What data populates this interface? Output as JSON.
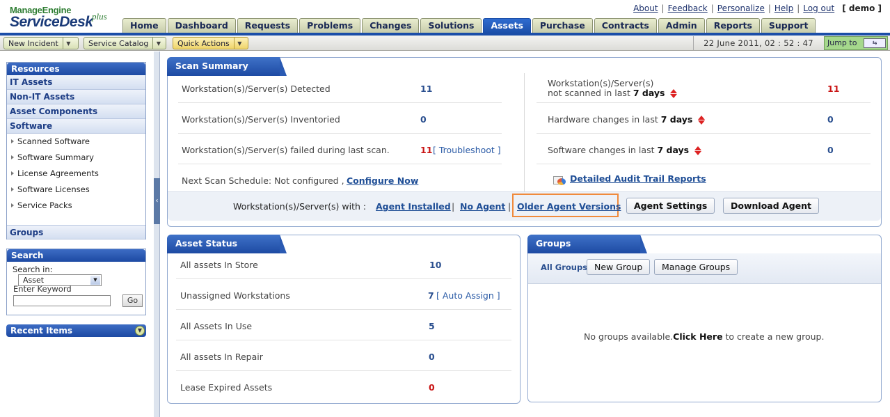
{
  "header": {
    "logo_line1": "ManageEngine",
    "logo_line2": "ServiceDesk",
    "logo_plus": "plus",
    "links": [
      "About",
      "Feedback",
      "Personalize",
      "Help",
      "Log out"
    ],
    "user": "[ demo ]",
    "tabs": [
      {
        "label": "Home",
        "active": false
      },
      {
        "label": "Dashboard",
        "active": false
      },
      {
        "label": "Requests",
        "active": false
      },
      {
        "label": "Problems",
        "active": false
      },
      {
        "label": "Changes",
        "active": false
      },
      {
        "label": "Solutions",
        "active": false
      },
      {
        "label": "Assets",
        "active": true
      },
      {
        "label": "Purchase",
        "active": false
      },
      {
        "label": "Contracts",
        "active": false
      },
      {
        "label": "Admin",
        "active": false
      },
      {
        "label": "Reports",
        "active": false
      },
      {
        "label": "Support",
        "active": false
      }
    ]
  },
  "toolbar": {
    "new_incident": "New Incident",
    "service_catalog": "Service Catalog",
    "quick_actions": "Quick Actions",
    "datetime": "22 June 2011, 02 : 52 : 47",
    "jump_to": "Jump to"
  },
  "sidebar": {
    "resources_title": "Resources",
    "categories": [
      "IT Assets",
      "Non-IT Assets",
      "Asset Components",
      "Software"
    ],
    "software_items": [
      "Scanned Software",
      "Software Summary",
      "License Agreements",
      "Software Licenses",
      "Service Packs"
    ],
    "groups_label": "Groups",
    "search_title": "Search",
    "search_in_label": "Search in:",
    "search_in_value": "Asset",
    "keyword_label": "Enter Keyword",
    "go_label": "Go",
    "recent_title": "Recent Items"
  },
  "scan_summary": {
    "title": "Scan Summary",
    "detected_label": "Workstation(s)/Server(s) Detected",
    "detected_value": "11",
    "inventoried_label": "Workstation(s)/Server(s) Inventoried",
    "inventoried_value": "0",
    "failed_label": "Workstation(s)/Server(s) failed during last scan.",
    "failed_value": "11",
    "troubleshoot": "[ Troubleshoot ]",
    "next_scan_label": "Next Scan Schedule: Not configured ,",
    "configure_now": "Configure Now",
    "not_scanned_line1": "Workstation(s)/Server(s)",
    "not_scanned_line2": "not scanned in last",
    "seven_days": "7 days",
    "not_scanned_value": "11",
    "hw_label": "Hardware changes in last",
    "hw_value": "0",
    "sw_label": "Software changes in last",
    "sw_value": "0",
    "audit_link": "Detailed Audit Trail Reports",
    "agent_with": "Workstation(s)/Server(s) with :",
    "agent_installed": "Agent Installed",
    "no_agent": "No Agent",
    "older_agent": "Older Agent Versions",
    "pipe": "|",
    "agent_settings": "Agent Settings",
    "download_agent": "Download Agent",
    "highlight_color": "#f08a3c"
  },
  "asset_status": {
    "title": "Asset Status",
    "rows": [
      {
        "label": "All assets In Store",
        "value": "10",
        "extra": ""
      },
      {
        "label": "Unassigned Workstations",
        "value": "7",
        "extra": "[ Auto Assign ]"
      },
      {
        "label": "All Assets In Use",
        "value": "5",
        "extra": ""
      },
      {
        "label": "All assets In Repair",
        "value": "0",
        "extra": ""
      },
      {
        "label": "Lease Expired Assets",
        "value": "0",
        "extra": ""
      }
    ]
  },
  "groups": {
    "title": "Groups",
    "all_groups": "All Groups",
    "new_group": "New Group",
    "manage_groups": "Manage Groups",
    "empty_msg": "No groups available.",
    "click_here": "Click Here",
    "empty_msg_tail": " to create a new group."
  }
}
